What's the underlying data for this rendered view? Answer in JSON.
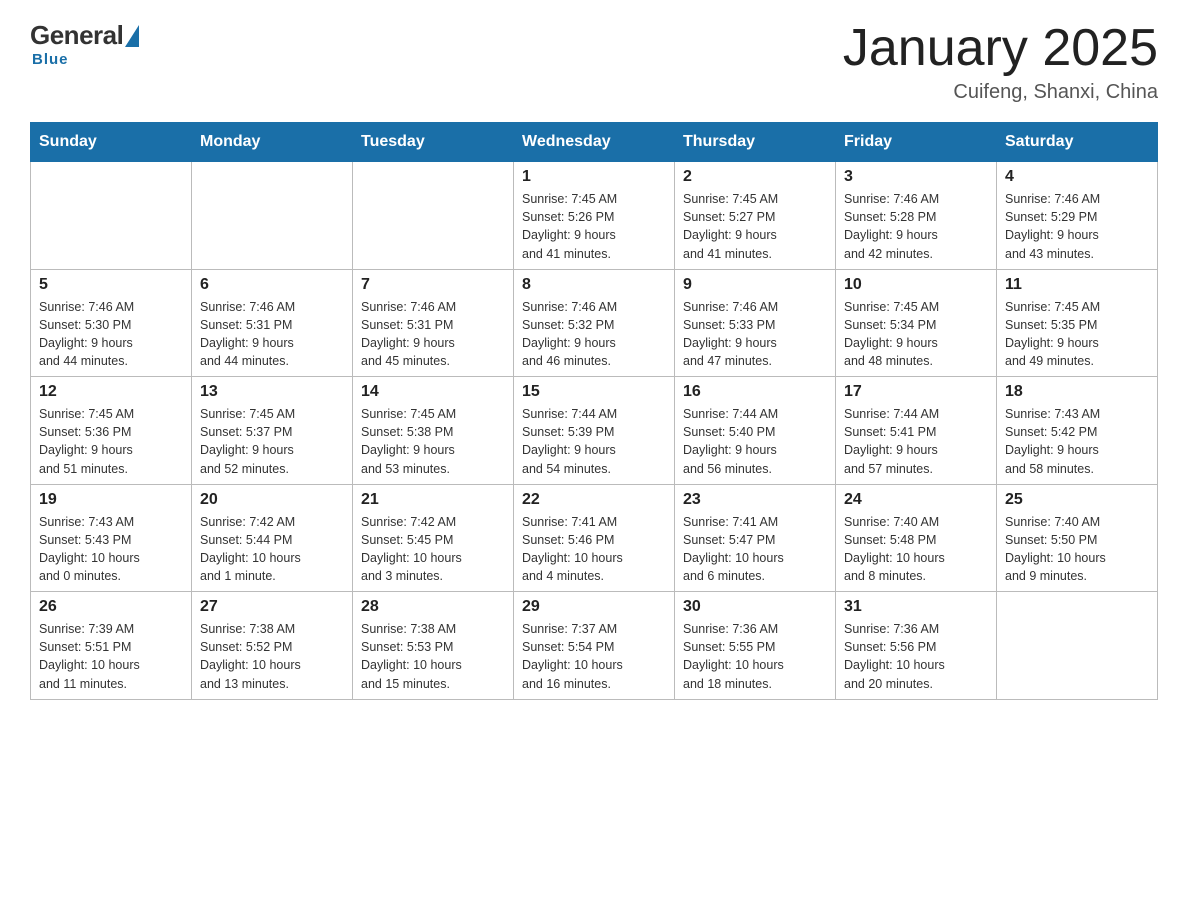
{
  "header": {
    "logo": {
      "general": "General",
      "blue": "Blue"
    },
    "title": "January 2025",
    "location": "Cuifeng, Shanxi, China"
  },
  "calendar": {
    "weekdays": [
      "Sunday",
      "Monday",
      "Tuesday",
      "Wednesday",
      "Thursday",
      "Friday",
      "Saturday"
    ],
    "weeks": [
      [
        {
          "day": "",
          "info": ""
        },
        {
          "day": "",
          "info": ""
        },
        {
          "day": "",
          "info": ""
        },
        {
          "day": "1",
          "info": "Sunrise: 7:45 AM\nSunset: 5:26 PM\nDaylight: 9 hours\nand 41 minutes."
        },
        {
          "day": "2",
          "info": "Sunrise: 7:45 AM\nSunset: 5:27 PM\nDaylight: 9 hours\nand 41 minutes."
        },
        {
          "day": "3",
          "info": "Sunrise: 7:46 AM\nSunset: 5:28 PM\nDaylight: 9 hours\nand 42 minutes."
        },
        {
          "day": "4",
          "info": "Sunrise: 7:46 AM\nSunset: 5:29 PM\nDaylight: 9 hours\nand 43 minutes."
        }
      ],
      [
        {
          "day": "5",
          "info": "Sunrise: 7:46 AM\nSunset: 5:30 PM\nDaylight: 9 hours\nand 44 minutes."
        },
        {
          "day": "6",
          "info": "Sunrise: 7:46 AM\nSunset: 5:31 PM\nDaylight: 9 hours\nand 44 minutes."
        },
        {
          "day": "7",
          "info": "Sunrise: 7:46 AM\nSunset: 5:31 PM\nDaylight: 9 hours\nand 45 minutes."
        },
        {
          "day": "8",
          "info": "Sunrise: 7:46 AM\nSunset: 5:32 PM\nDaylight: 9 hours\nand 46 minutes."
        },
        {
          "day": "9",
          "info": "Sunrise: 7:46 AM\nSunset: 5:33 PM\nDaylight: 9 hours\nand 47 minutes."
        },
        {
          "day": "10",
          "info": "Sunrise: 7:45 AM\nSunset: 5:34 PM\nDaylight: 9 hours\nand 48 minutes."
        },
        {
          "day": "11",
          "info": "Sunrise: 7:45 AM\nSunset: 5:35 PM\nDaylight: 9 hours\nand 49 minutes."
        }
      ],
      [
        {
          "day": "12",
          "info": "Sunrise: 7:45 AM\nSunset: 5:36 PM\nDaylight: 9 hours\nand 51 minutes."
        },
        {
          "day": "13",
          "info": "Sunrise: 7:45 AM\nSunset: 5:37 PM\nDaylight: 9 hours\nand 52 minutes."
        },
        {
          "day": "14",
          "info": "Sunrise: 7:45 AM\nSunset: 5:38 PM\nDaylight: 9 hours\nand 53 minutes."
        },
        {
          "day": "15",
          "info": "Sunrise: 7:44 AM\nSunset: 5:39 PM\nDaylight: 9 hours\nand 54 minutes."
        },
        {
          "day": "16",
          "info": "Sunrise: 7:44 AM\nSunset: 5:40 PM\nDaylight: 9 hours\nand 56 minutes."
        },
        {
          "day": "17",
          "info": "Sunrise: 7:44 AM\nSunset: 5:41 PM\nDaylight: 9 hours\nand 57 minutes."
        },
        {
          "day": "18",
          "info": "Sunrise: 7:43 AM\nSunset: 5:42 PM\nDaylight: 9 hours\nand 58 minutes."
        }
      ],
      [
        {
          "day": "19",
          "info": "Sunrise: 7:43 AM\nSunset: 5:43 PM\nDaylight: 10 hours\nand 0 minutes."
        },
        {
          "day": "20",
          "info": "Sunrise: 7:42 AM\nSunset: 5:44 PM\nDaylight: 10 hours\nand 1 minute."
        },
        {
          "day": "21",
          "info": "Sunrise: 7:42 AM\nSunset: 5:45 PM\nDaylight: 10 hours\nand 3 minutes."
        },
        {
          "day": "22",
          "info": "Sunrise: 7:41 AM\nSunset: 5:46 PM\nDaylight: 10 hours\nand 4 minutes."
        },
        {
          "day": "23",
          "info": "Sunrise: 7:41 AM\nSunset: 5:47 PM\nDaylight: 10 hours\nand 6 minutes."
        },
        {
          "day": "24",
          "info": "Sunrise: 7:40 AM\nSunset: 5:48 PM\nDaylight: 10 hours\nand 8 minutes."
        },
        {
          "day": "25",
          "info": "Sunrise: 7:40 AM\nSunset: 5:50 PM\nDaylight: 10 hours\nand 9 minutes."
        }
      ],
      [
        {
          "day": "26",
          "info": "Sunrise: 7:39 AM\nSunset: 5:51 PM\nDaylight: 10 hours\nand 11 minutes."
        },
        {
          "day": "27",
          "info": "Sunrise: 7:38 AM\nSunset: 5:52 PM\nDaylight: 10 hours\nand 13 minutes."
        },
        {
          "day": "28",
          "info": "Sunrise: 7:38 AM\nSunset: 5:53 PM\nDaylight: 10 hours\nand 15 minutes."
        },
        {
          "day": "29",
          "info": "Sunrise: 7:37 AM\nSunset: 5:54 PM\nDaylight: 10 hours\nand 16 minutes."
        },
        {
          "day": "30",
          "info": "Sunrise: 7:36 AM\nSunset: 5:55 PM\nDaylight: 10 hours\nand 18 minutes."
        },
        {
          "day": "31",
          "info": "Sunrise: 7:36 AM\nSunset: 5:56 PM\nDaylight: 10 hours\nand 20 minutes."
        },
        {
          "day": "",
          "info": ""
        }
      ]
    ]
  }
}
